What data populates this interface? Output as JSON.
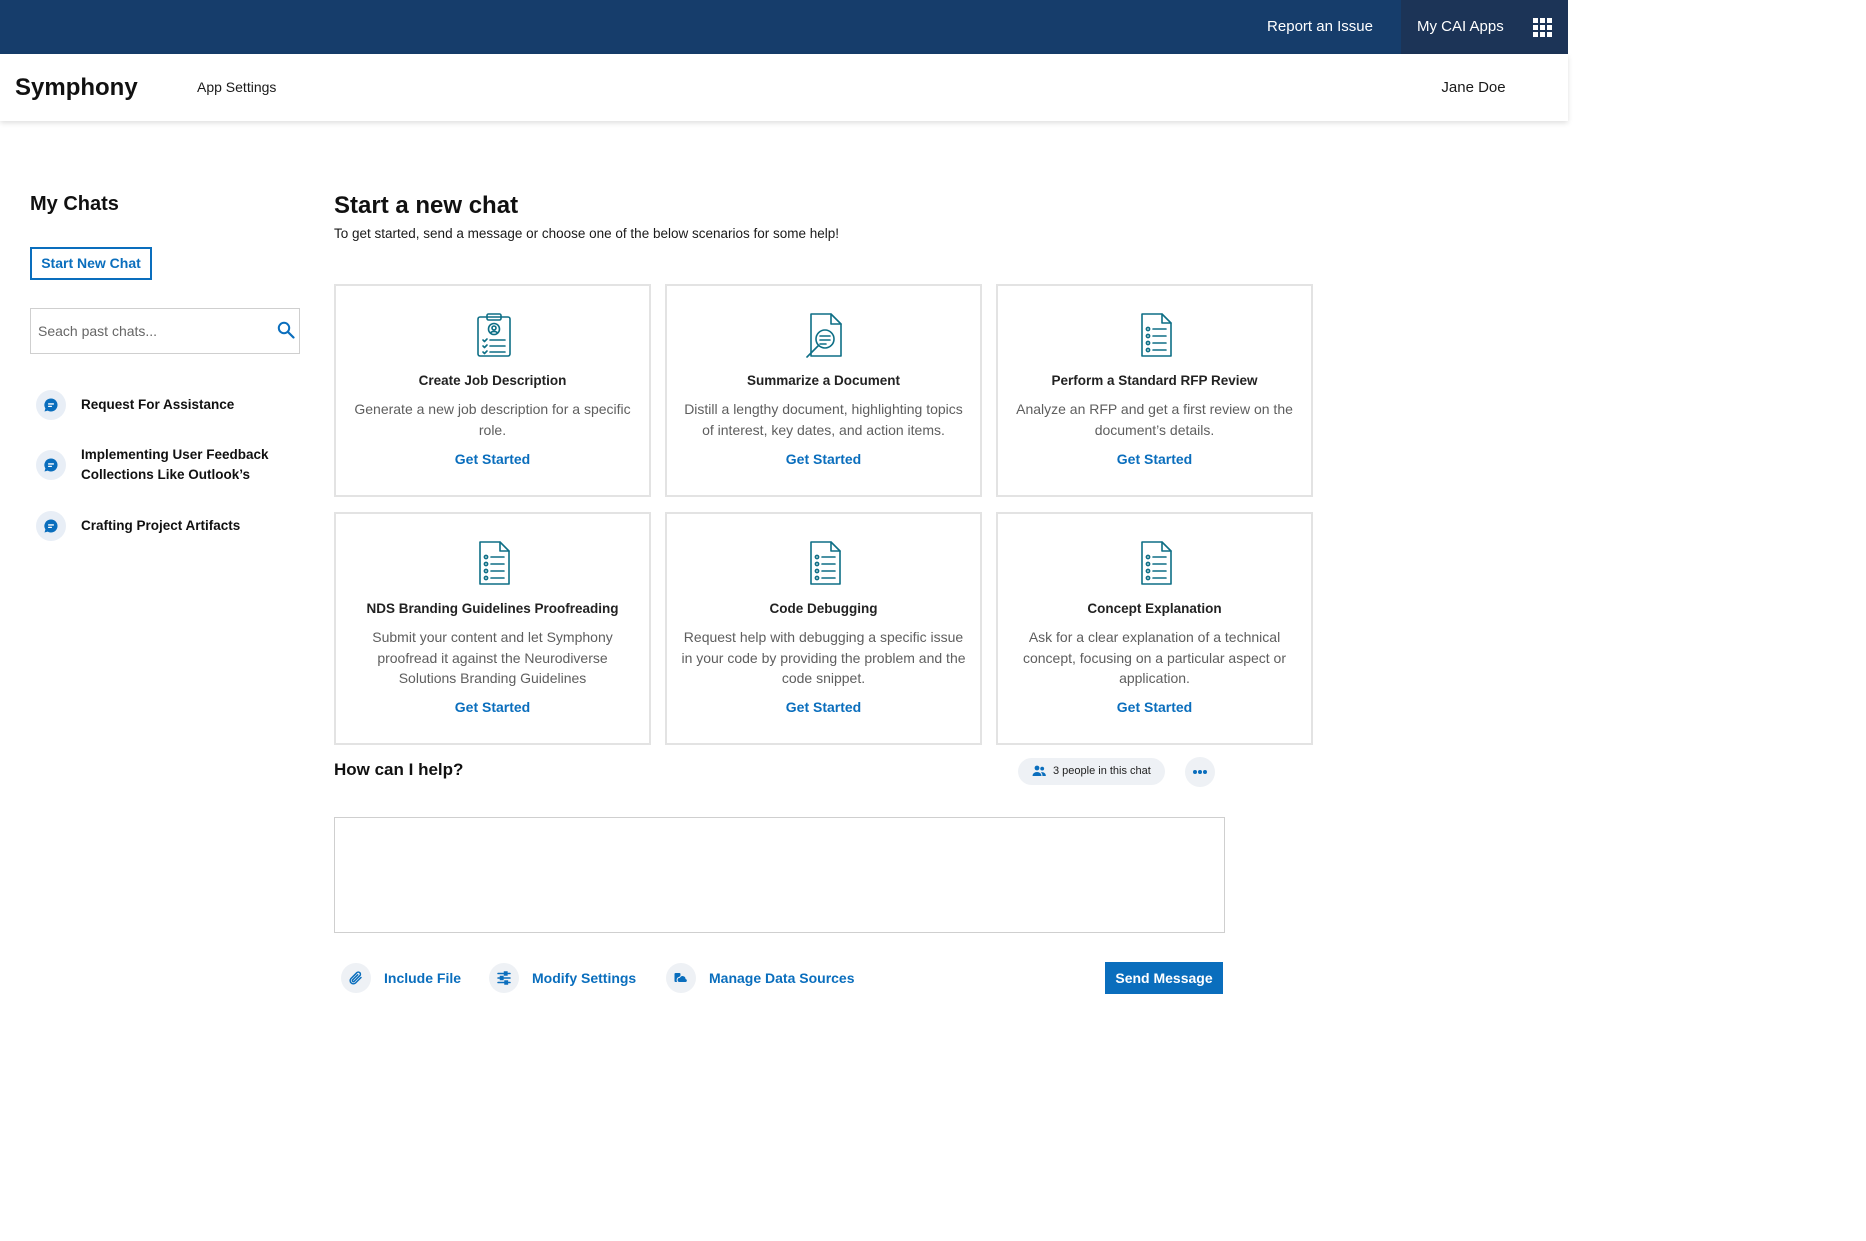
{
  "topbar": {
    "report_label": "Report an Issue",
    "apps_label": "My CAI Apps",
    "apps_icon": "app-grid-icon"
  },
  "header": {
    "brand": "Symphony",
    "settings_label": "App Settings",
    "user_name": "Jane Doe"
  },
  "sidebar": {
    "title": "My Chats",
    "new_chat_label": "Start New Chat",
    "search_placeholder": "Seach past chats...",
    "search_icon": "search-icon",
    "chats": [
      {
        "label": "Request For Assistance",
        "icon": "chat-bubble-icon"
      },
      {
        "label_line1": "Implementing User Feedback",
        "label_line2": "Collections Like Outlook’s",
        "icon": "chat-bubble-icon"
      },
      {
        "label": "Crafting Project Artifacts",
        "icon": "chat-bubble-icon"
      }
    ]
  },
  "main": {
    "title": "Start a new chat",
    "subtitle": "To get started, send a message or choose one of the below scenarios for some help!",
    "cards": [
      {
        "icon": "clipboard-person-icon",
        "title": "Create Job Description",
        "description": "Generate a new job description for a specific role.",
        "action": "Get Started"
      },
      {
        "icon": "document-search-icon",
        "title": "Summarize a Document",
        "description": "Distill a lengthy document, highlighting topics of interest, key dates, and action items.",
        "action": "Get Started"
      },
      {
        "icon": "document-list-icon",
        "title": "Perform a Standard RFP Review",
        "description": "Analyze an RFP and get a first review on the document’s details.",
        "action": "Get Started"
      },
      {
        "icon": "document-list-icon",
        "title": "NDS Branding Guidelines Proofreading",
        "description": "Submit your content and let Symphony proofread it against the Neurodiverse Solutions Branding Guidelines",
        "action": "Get Started"
      },
      {
        "icon": "document-list-icon",
        "title": "Code Debugging",
        "description": "Request help with debugging a specific issue in your code by providing the problem and the code snippet.",
        "action": "Get Started"
      },
      {
        "icon": "document-list-icon",
        "title": "Concept Explanation",
        "description": "Ask for a clear explanation of a technical concept, focusing on a particular aspect or application.",
        "action": "Get Started"
      }
    ]
  },
  "composer": {
    "title": "How can I help?",
    "people_label": "3 people in this chat",
    "message_value": "",
    "actions": [
      {
        "label": "Include File",
        "icon": "paperclip-icon"
      },
      {
        "label": "Modify Settings",
        "icon": "sliders-icon"
      },
      {
        "label": "Manage Data Sources",
        "icon": "data-sources-icon"
      }
    ],
    "send_label": "Send Message"
  },
  "colors": {
    "topbar": "#163d6b",
    "apps_bg": "#1c3457",
    "accent": "#0a6ebd",
    "icon_teal": "#0e6f86"
  }
}
